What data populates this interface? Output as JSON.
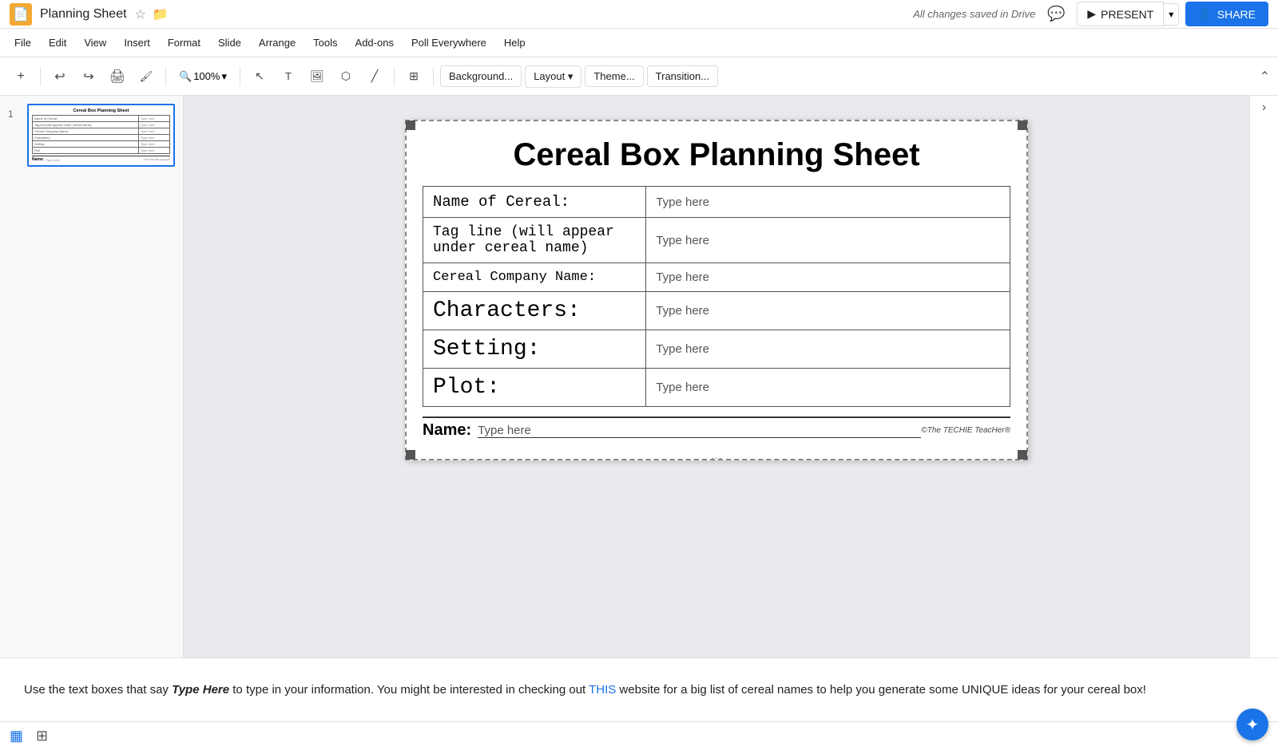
{
  "app": {
    "icon": "📄",
    "title": "Planning Sheet",
    "save_status": "All changes saved in Drive"
  },
  "menu": {
    "items": [
      "File",
      "Edit",
      "View",
      "Insert",
      "Format",
      "Slide",
      "Arrange",
      "Tools",
      "Add-ons",
      "Poll Everywhere",
      "Help"
    ]
  },
  "toolbar": {
    "zoom_label": "100%",
    "background_btn": "Background...",
    "layout_btn": "Layout ▾",
    "theme_btn": "Theme...",
    "transition_btn": "Transition..."
  },
  "header_buttons": {
    "present": "PRESENT",
    "share": "SHARE"
  },
  "slide": {
    "title": "Cereal Box Planning Sheet",
    "rows": [
      {
        "label": "Name of Cereal:",
        "input": "Type here",
        "label_size": "normal"
      },
      {
        "label": "Tag line (will appear\nunder cereal name)",
        "input": "Type here",
        "label_size": "normal"
      },
      {
        "label": "Cereal Company Name:",
        "input": "Type here",
        "label_size": "normal"
      },
      {
        "label": "Characters:",
        "input": "Type here",
        "label_size": "large"
      },
      {
        "label": "Setting:",
        "input": "Type here",
        "label_size": "large"
      },
      {
        "label": "Plot:",
        "input": "Type here",
        "label_size": "large"
      }
    ],
    "name_label": "Name:",
    "name_input": "Type here",
    "copyright": "©The TECHIE TeacHer®"
  },
  "bottom_note": {
    "text_before": "Use the text boxes that say ",
    "type_here": "Type Here",
    "text_middle": " to type in your information. You might be interested in checking out ",
    "link_text": "THIS",
    "text_after": " website for a big list of cereal names to help you generate some UNIQUE ideas for your cereal box!"
  },
  "thumbnail": {
    "title": "Cereal Box Planning Sheet",
    "rows": [
      "Name of Cereal:",
      "Tag line (will appear\nunder cereal name):",
      "Cereal Company Name:",
      "Characters:",
      "Setting:",
      "Plot:"
    ]
  }
}
